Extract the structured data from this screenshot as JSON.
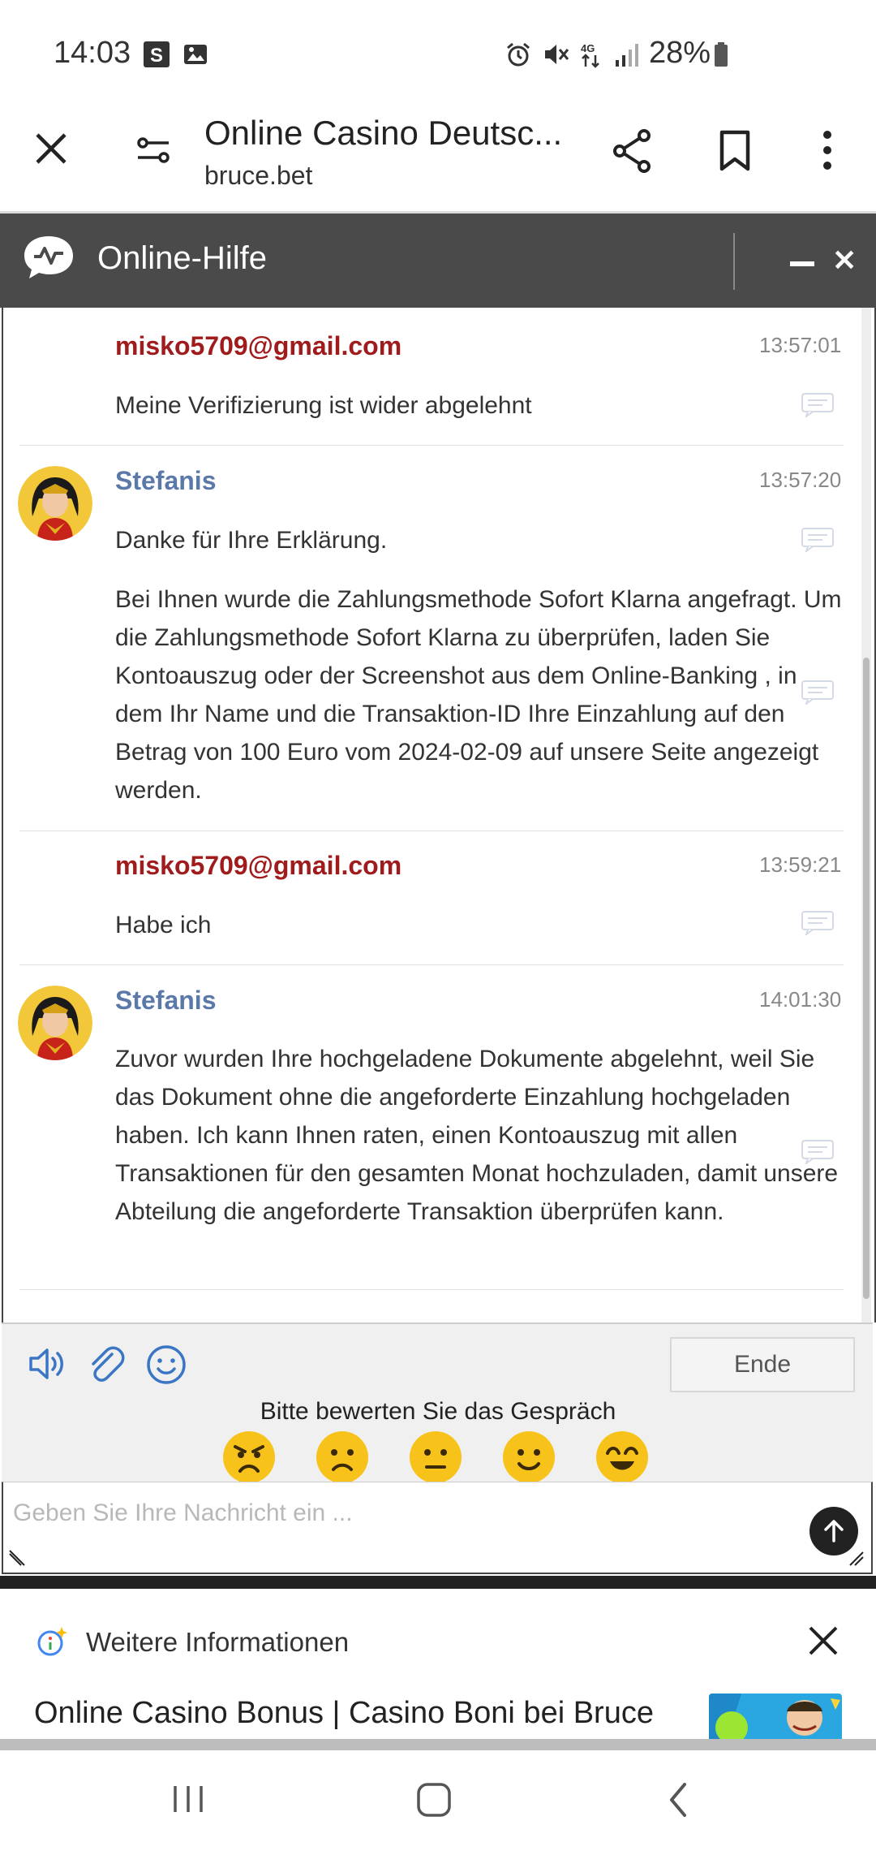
{
  "status_bar": {
    "time": "14:03",
    "battery": "28%",
    "icons": [
      "s-app-icon",
      "image-icon",
      "alarm-icon",
      "mute-icon",
      "4g-icon",
      "signal-icon",
      "battery-icon"
    ]
  },
  "browser": {
    "page_title": "Online Casino Deutsc...",
    "url": "bruce.bet",
    "icons": [
      "close-icon",
      "site-settings-icon",
      "share-icon",
      "bookmark-icon",
      "more-icon"
    ]
  },
  "chat": {
    "title": "Online-Hilfe",
    "messages": [
      {
        "sender": "misko5709@gmail.com",
        "time": "13:57:01",
        "paragraphs": [
          "Meine Verifizierung ist wider abgelehnt"
        ]
      },
      {
        "sender": "Stefanis",
        "time": "13:57:20",
        "paragraphs": [
          "Danke für Ihre Erklärung.",
          "Bei Ihnen wurde die Zahlungsmethode Sofort Klarna angefragt. Um die Zahlungsmethode Sofort Klarna zu überprüfen, laden Sie Kontoauszug oder der Screenshot aus dem Online-Banking , in dem Ihr Name und die Transaktion-ID Ihre Einzahlung auf den Betrag von 100 Euro vom 2024-02-09 auf unsere Seite angezeigt werden."
        ]
      },
      {
        "sender": "misko5709@gmail.com",
        "time": "13:59:21",
        "paragraphs": [
          "Habe ich"
        ]
      },
      {
        "sender": "Stefanis",
        "time": "14:01:30",
        "paragraphs": [
          "Zuvor wurden Ihre hochgeladene Dokumente abgelehnt, weil Sie das Dokument ohne die angeforderte Einzahlung hochgeladen haben. Ich kann Ihnen raten, einen Kontoauszug mit allen Transaktionen für den gesamten Monat hochzuladen, damit unsere Abteilung die angeforderte Transaktion überprüfen kann."
        ]
      }
    ],
    "end_label": "Ende",
    "rating_label": "Bitte bewerten Sie das Gespräch",
    "input_placeholder": "Geben Sie Ihre Nachricht ein ..."
  },
  "info_panel": {
    "title": "Weitere Informationen",
    "result_title": "Online Casino Bonus | Casino Boni bei Bruce Bet"
  },
  "colors": {
    "header_bg": "#4a4a4a",
    "user_name": "#a01c1c",
    "agent_name": "#5a78a8",
    "icon_blue": "#3a76c4",
    "emoji_yellow": "#f7c21a"
  }
}
